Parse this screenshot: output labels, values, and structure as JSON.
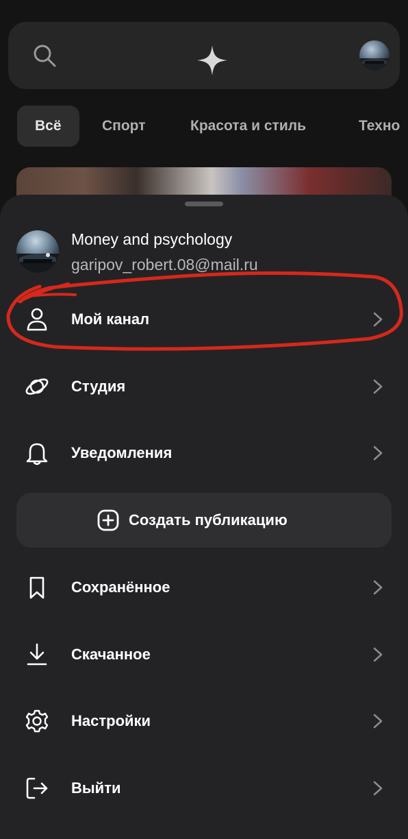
{
  "topbar": {
    "search_icon": "search-icon",
    "center_icon": "sparkle-icon",
    "avatar": "user-avatar"
  },
  "tabs": [
    {
      "label": "Всё",
      "active": true
    },
    {
      "label": "Спорт",
      "active": false
    },
    {
      "label": "Красота и стиль",
      "active": false
    },
    {
      "label": "Техно",
      "active": false
    }
  ],
  "profile": {
    "name": "Money and psychology",
    "email": "garipov_robert.08@mail.ru"
  },
  "menu": [
    {
      "label": "Мой канал",
      "icon": "person-icon"
    },
    {
      "label": "Студия",
      "icon": "orbit-icon"
    },
    {
      "label": "Уведомления",
      "icon": "bell-icon"
    },
    {
      "label": "Сохранённое",
      "icon": "bookmark-icon"
    },
    {
      "label": "Скачанное",
      "icon": "download-icon"
    },
    {
      "label": "Настройки",
      "icon": "gear-icon"
    },
    {
      "label": "Выйти",
      "icon": "logout-icon"
    }
  ],
  "create_button": {
    "label": "Создать публикацию",
    "icon": "plus-square-icon"
  },
  "colors": {
    "background": "#141414",
    "sheet": "#232325",
    "button": "#2f2f31",
    "annotation": "#d6281c"
  }
}
